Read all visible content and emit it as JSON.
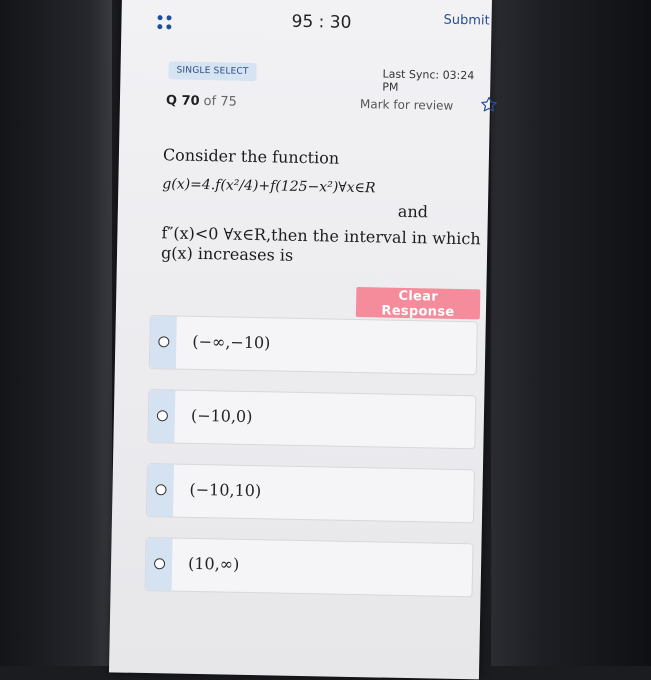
{
  "header": {
    "timer": "95 : 30",
    "submit_label": "Submit"
  },
  "meta": {
    "badge": "SINGLE SELECT",
    "last_sync": "Last Sync: 03:24 PM",
    "question_number": "Q 70",
    "question_total": "of 75",
    "mark_review": "Mark for review"
  },
  "question": {
    "line1": "Consider the function",
    "line2": "g(x)=4.f(x²/4)+f(125−x²)∀x∈R",
    "and": "and",
    "line3": "f″(x)<0 ∀x∈R,then the interval in which",
    "line4": "g(x) increases is"
  },
  "clear_response_label": "Clear Response",
  "options": [
    {
      "label": "(−∞,−10)"
    },
    {
      "label": "(−10,0)"
    },
    {
      "label": "(−10,10)"
    },
    {
      "label": "(10,∞)"
    }
  ],
  "icons": {
    "menu": "menu-dots-icon",
    "star": "star-outline-icon",
    "radio": "radio-empty-icon"
  },
  "colors": {
    "accent": "#2b4f92",
    "clear_button": "#f58c9c",
    "badge_bg": "#d6e3f3"
  }
}
